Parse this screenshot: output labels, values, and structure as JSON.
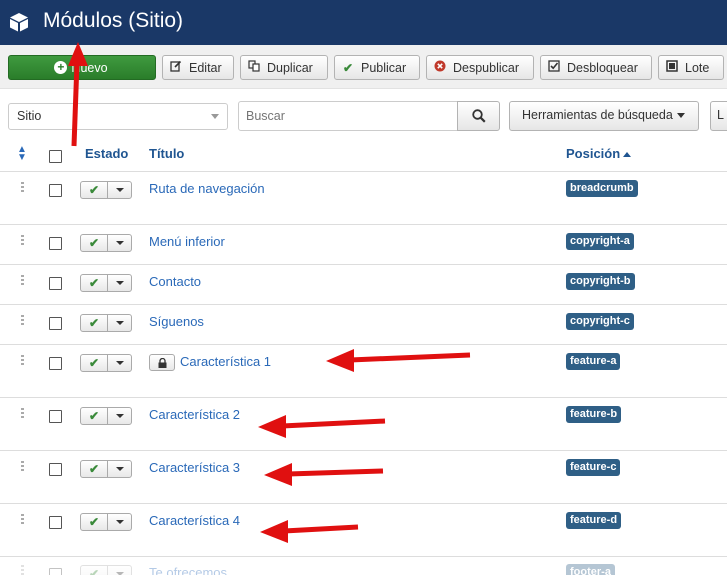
{
  "header": {
    "title": "Módulos (Sitio)",
    "icon": "cube-icon"
  },
  "toolbar": {
    "nuevo": "Nuevo",
    "editar": "Editar",
    "duplicar": "Duplicar",
    "publicar": "Publicar",
    "despublicar": "Despublicar",
    "desbloquear": "Desbloquear",
    "lote": "Lote"
  },
  "filters": {
    "site_select": "Sitio",
    "search_placeholder": "Buscar",
    "tools": "Herramientas de búsqueda",
    "list_partial": "L"
  },
  "table": {
    "headers": {
      "estado": "Estado",
      "titulo": "Título",
      "posicion": "Posición"
    },
    "rows": [
      {
        "title": "Ruta de navegación",
        "position": "breadcrumb",
        "locked": false
      },
      {
        "title": "Menú inferior",
        "position": "copyright-a",
        "locked": false
      },
      {
        "title": "Contacto",
        "position": "copyright-b",
        "locked": false
      },
      {
        "title": "Síguenos",
        "position": "copyright-c",
        "locked": false
      },
      {
        "title": "Característica 1",
        "position": "feature-a",
        "locked": true
      },
      {
        "title": "Característica 2",
        "position": "feature-b",
        "locked": false
      },
      {
        "title": "Característica 3",
        "position": "feature-c",
        "locked": false
      },
      {
        "title": "Característica 4",
        "position": "feature-d",
        "locked": false
      },
      {
        "title": "Te ofrecemos",
        "position": "footer-a",
        "locked": false
      }
    ]
  },
  "colors": {
    "header_bg": "#1a3867",
    "accent_green": "#2a7d2a",
    "badge": "#2f5f86",
    "annotation": "#e01010"
  }
}
